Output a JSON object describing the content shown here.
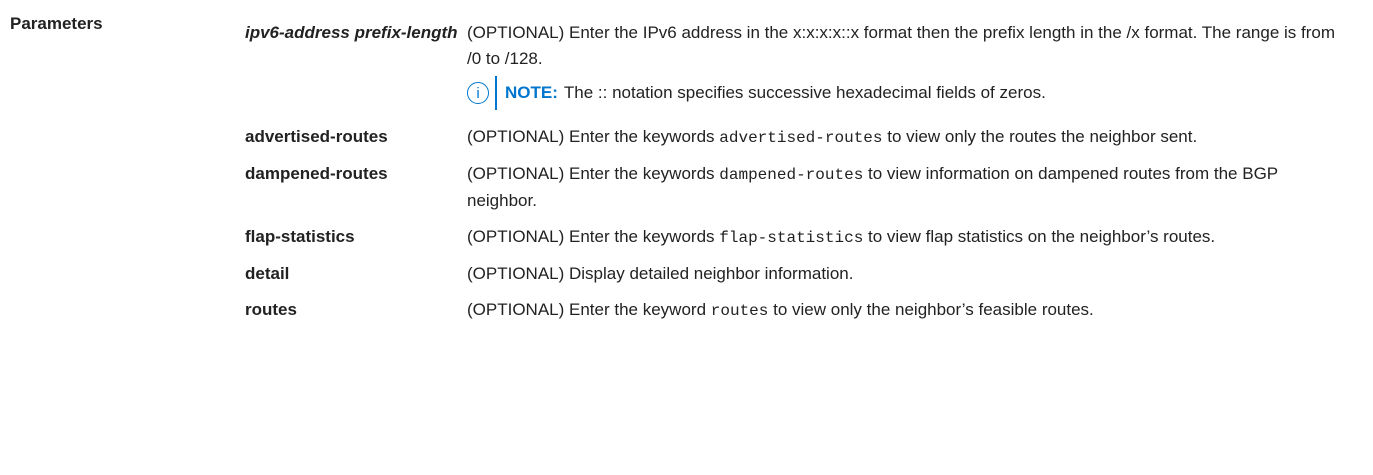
{
  "section_title": "Parameters",
  "params": [
    {
      "term": "ipv6-address prefix-length",
      "desc": "(OPTIONAL) Enter the IPv6 address in the x:x:x:x::x format then the prefix length in the /x format. The range is from /0 to /128.",
      "note_label": "NOTE:",
      "note_text": "The :: notation specifies successive hexadecimal fields of zeros."
    },
    {
      "term": "advertised-routes",
      "desc_before": "(OPTIONAL) Enter the keywords",
      "code": "advertised-routes",
      "desc_after": "to view only the routes the neighbor sent."
    },
    {
      "term": "dampened-routes",
      "desc_before": "(OPTIONAL) Enter the keywords",
      "code": "dampened-routes",
      "desc_after": "to view information on dampened routes from the BGP neighbor."
    },
    {
      "term": "flap-statistics",
      "desc_before": "(OPTIONAL) Enter the keywords",
      "code": "flap-statistics",
      "desc_after": "to view flap statistics on the neighbor’s routes."
    },
    {
      "term": "detail",
      "desc": "(OPTIONAL) Display detailed neighbor information."
    },
    {
      "term": "routes",
      "desc_before": "(OPTIONAL) Enter the keyword",
      "code": "routes",
      "desc_after": "to view only the neighbor’s feasible routes."
    }
  ],
  "colors": {
    "note_accent": "#0076ce",
    "text": "#222222"
  }
}
